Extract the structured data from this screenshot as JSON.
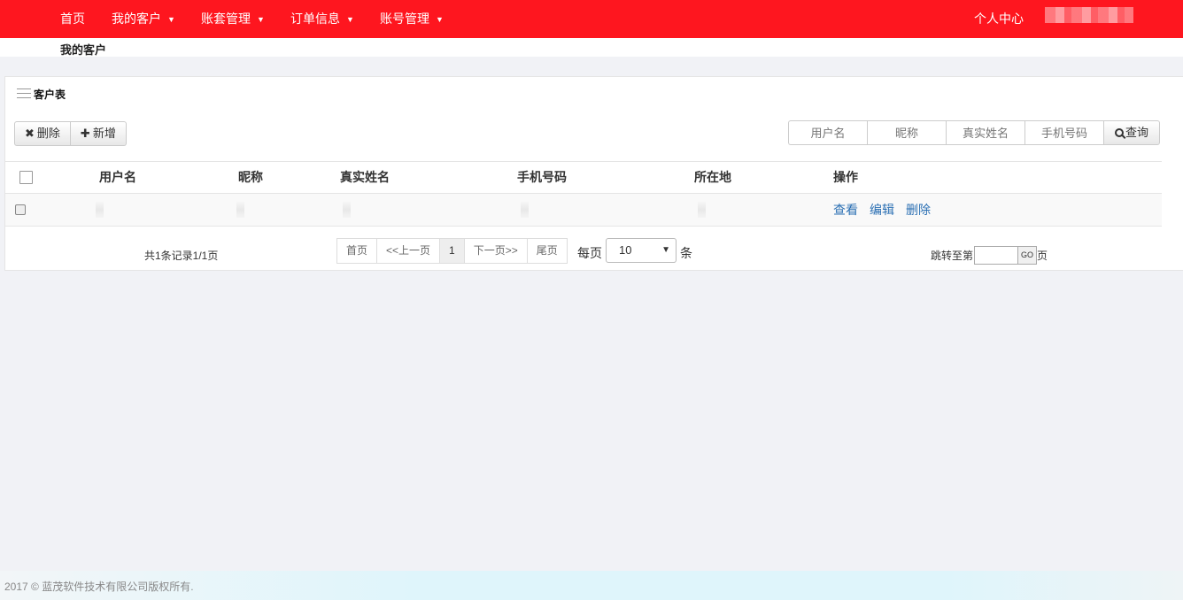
{
  "nav": {
    "items": [
      {
        "label": "首页",
        "has_dropdown": false
      },
      {
        "label": "我的客户",
        "has_dropdown": true
      },
      {
        "label": "账套管理",
        "has_dropdown": true
      },
      {
        "label": "订单信息",
        "has_dropdown": true
      },
      {
        "label": "账号管理",
        "has_dropdown": true
      }
    ],
    "caret": "▼",
    "personal_center": "个人中心",
    "brand_color": "#fe161f"
  },
  "breadcrumb": "我的客户",
  "panel": {
    "title": "客户表",
    "toolbar": {
      "delete_label": "删除",
      "add_label": "新增"
    },
    "search": {
      "username_placeholder": "用户名",
      "nickname_placeholder": "昵称",
      "realname_placeholder": "真实姓名",
      "phone_placeholder": "手机号码",
      "query_label": "查询"
    },
    "table": {
      "columns": [
        "用户名",
        "昵称",
        "真实姓名",
        "手机号码",
        "所在地",
        "操作"
      ],
      "rows": [
        {
          "actions": [
            "查看",
            "编辑",
            "删除"
          ]
        }
      ]
    },
    "pagination": {
      "summary": "共1条记录1/1页",
      "first": "首页",
      "prev": "<<上一页",
      "current": "1",
      "next": "下一页>>",
      "last": "尾页",
      "per_page_label": "每页",
      "per_page_value": "10",
      "per_page_unit": "条",
      "jump_label": "跳转至第",
      "go_label": "GO",
      "jump_unit": "页"
    }
  },
  "footer": {
    "copyright": "2017 © 蓝茂软件技术有限公司版权所有."
  },
  "colors": {
    "link": "#2a6fb3",
    "page_bg": "#f1f2f6"
  }
}
